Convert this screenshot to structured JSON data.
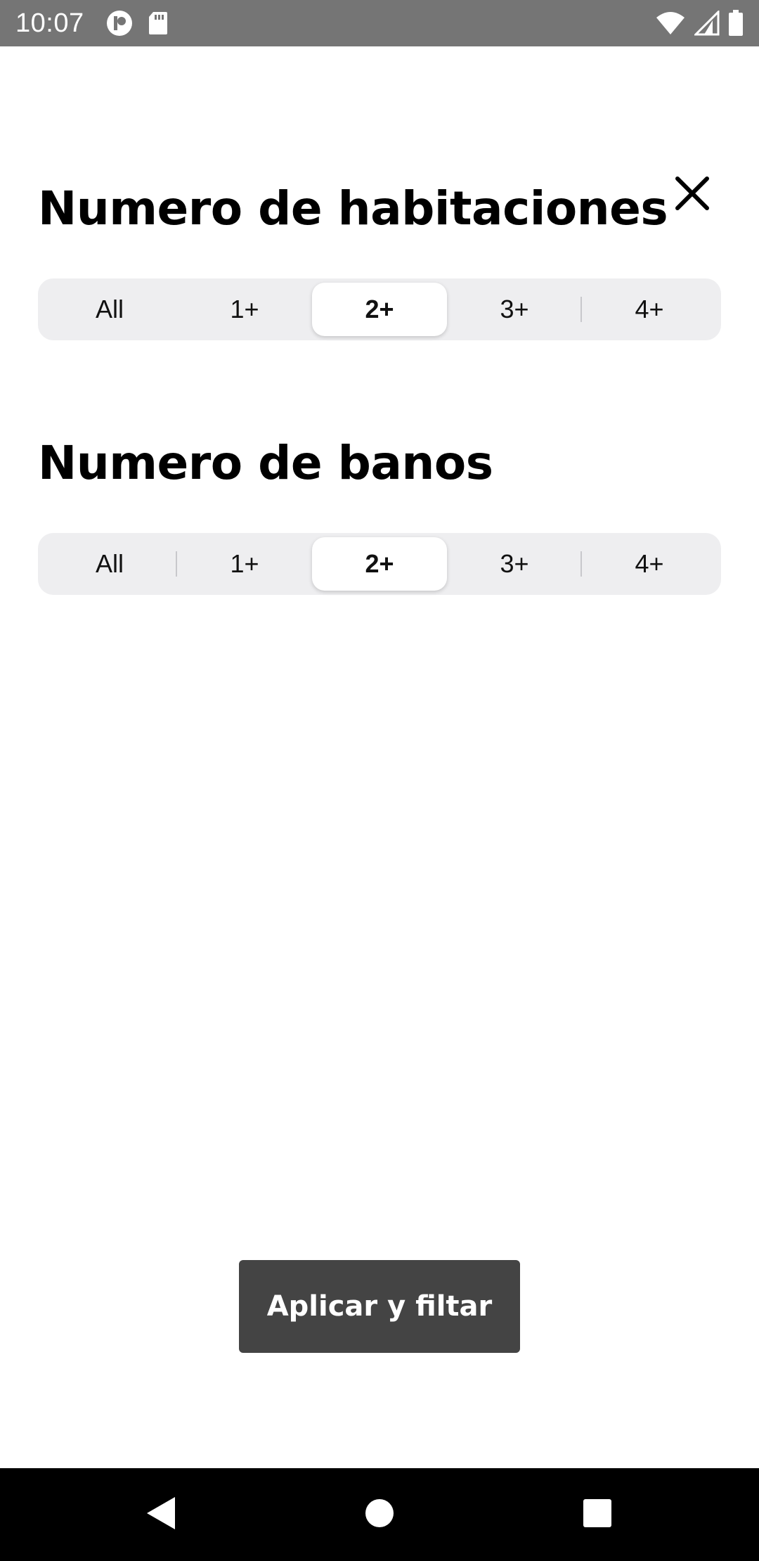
{
  "status_bar": {
    "time": "10:07",
    "left_icons": [
      "app-notification-icon",
      "sd-card-icon"
    ],
    "right_icons": [
      "wifi-icon",
      "cell-signal-icon",
      "battery-icon"
    ]
  },
  "dialog": {
    "close_icon": "close-icon",
    "bedrooms": {
      "title": "Numero de habitaciones",
      "options": [
        "All",
        "1+",
        "2+",
        "3+",
        "4+"
      ],
      "selected": "2+"
    },
    "bathrooms": {
      "title": "Numero de banos",
      "options": [
        "All",
        "1+",
        "2+",
        "3+",
        "4+"
      ],
      "selected": "2+"
    },
    "apply_label": "Aplicar y filtar"
  },
  "nav_bar": {
    "buttons": [
      "back-icon",
      "home-icon",
      "recents-icon"
    ]
  },
  "colors": {
    "status_bar": "#757575",
    "segment_bg": "#eeeef0",
    "button_bg": "#444444"
  }
}
